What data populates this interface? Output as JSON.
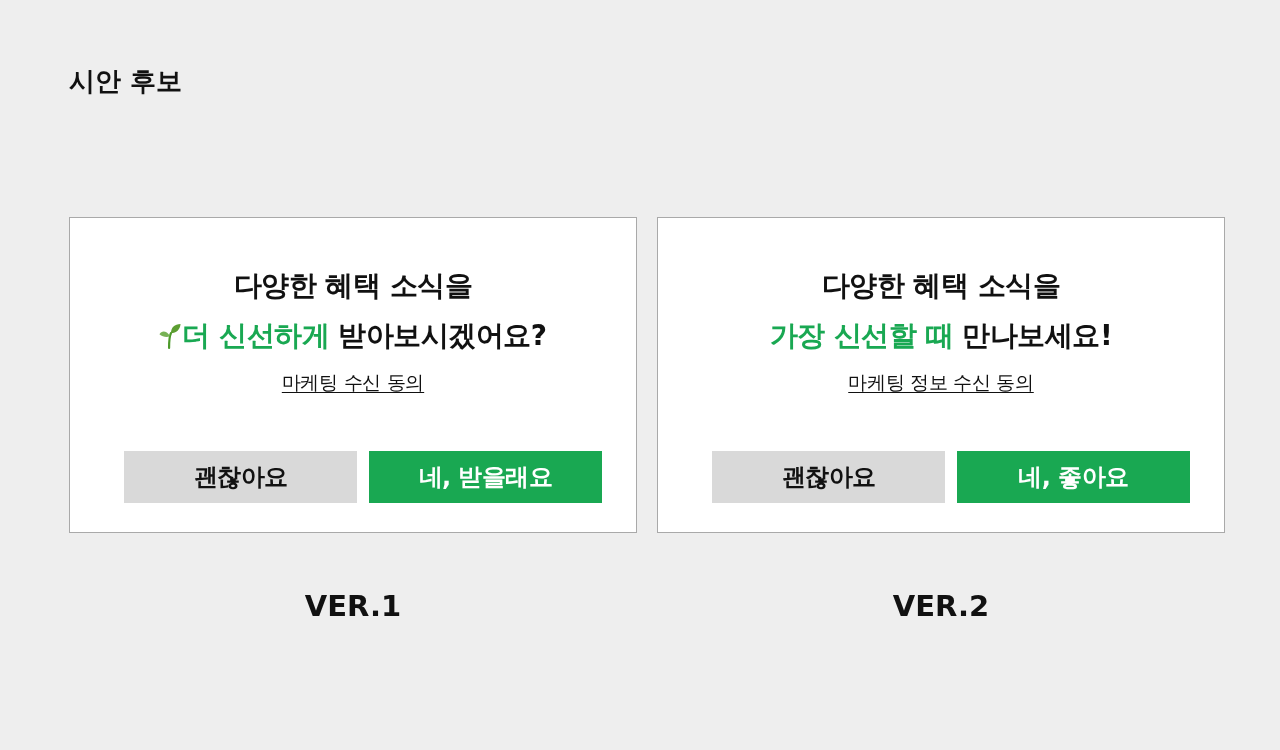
{
  "page_title": "시안 후보",
  "variants": [
    {
      "headline_lines": [
        [
          {
            "kind": "plain",
            "text": "다양한 혜택 소식을"
          }
        ],
        [
          {
            "kind": "icon"
          },
          {
            "kind": "highlight",
            "text": "더 신선하게"
          },
          {
            "kind": "plain",
            "text": " 받아보시겠어요?"
          }
        ]
      ],
      "consent_link": "마케팅 수신 동의",
      "buttons": [
        {
          "kind": "secondary",
          "label": "괜찮아요"
        },
        {
          "kind": "primary",
          "label": "네, 받을래요"
        }
      ],
      "version_label": "VER.1"
    },
    {
      "headline_lines": [
        [
          {
            "kind": "plain",
            "text": "다양한 혜택 소식을"
          }
        ],
        [
          {
            "kind": "highlight",
            "text": "가장 신선할 때"
          },
          {
            "kind": "plain",
            "text": " 만나보세요!"
          }
        ]
      ],
      "consent_link": "마케팅 정보 수신 동의",
      "buttons": [
        {
          "kind": "secondary",
          "label": "괜찮아요"
        },
        {
          "kind": "primary",
          "label": "네, 좋아요"
        }
      ],
      "version_label": "VER.2"
    }
  ]
}
